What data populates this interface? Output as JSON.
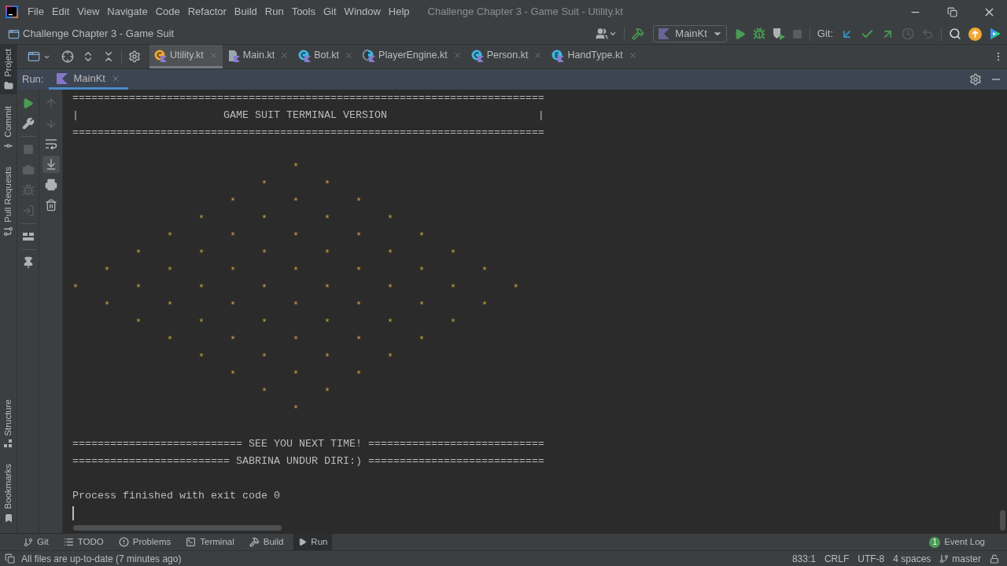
{
  "title_bar": {
    "menu": [
      "File",
      "Edit",
      "View",
      "Navigate",
      "Code",
      "Refactor",
      "Build",
      "Run",
      "Tools",
      "Git",
      "Window",
      "Help"
    ],
    "title": "Challenge Chapter 3 - Game Suit - Utility.kt"
  },
  "navigation_bar": {
    "project": "Challenge Chapter 3 - Game Suit",
    "left_actions": [
      {
        "kind": "account"
      },
      {
        "kind": "build"
      }
    ],
    "run_configuration": "MainKt",
    "run_actions": [
      {
        "kind": "run",
        "disabled": false
      },
      {
        "kind": "debug",
        "disabled": false
      },
      {
        "kind": "coverage",
        "disabled": false
      },
      {
        "kind": "stop",
        "disabled": true
      }
    ],
    "git_label": "Git:",
    "git_actions": [
      {
        "kind": "update",
        "disabled": false
      },
      {
        "kind": "commit",
        "disabled": false
      },
      {
        "kind": "push",
        "disabled": false
      },
      {
        "kind": "history",
        "disabled": true
      },
      {
        "kind": "rollback",
        "disabled": true
      }
    ],
    "end_actions": [
      {
        "kind": "search"
      },
      {
        "kind": "ide-update"
      },
      {
        "kind": "toolbox"
      }
    ]
  },
  "tool_strip": {
    "top": [
      {
        "kind": "project",
        "label": "Project",
        "selected": true
      },
      {
        "kind": "commit",
        "label": "Commit",
        "selected": false
      },
      {
        "kind": "pull-requests",
        "label": "Pull Requests",
        "selected": false
      }
    ],
    "bottom": [
      {
        "kind": "structure",
        "label": "Structure",
        "selected": false
      },
      {
        "kind": "bookmarks",
        "label": "Bookmarks",
        "selected": false
      }
    ]
  },
  "editor_tabs": [
    {
      "kind": "object",
      "label": "Utility.kt",
      "selected": true
    },
    {
      "kind": "file",
      "label": "Main.kt",
      "selected": false
    },
    {
      "kind": "class",
      "label": "Bot.kt",
      "selected": false
    },
    {
      "kind": "abstract",
      "label": "PlayerEngine.kt",
      "selected": false
    },
    {
      "kind": "class",
      "label": "Person.kt",
      "selected": false
    },
    {
      "kind": "enum",
      "label": "HandType.kt",
      "selected": false
    }
  ],
  "run_window": {
    "label": "Run:",
    "tabs": [
      {
        "label": "MainKt",
        "selected": true
      }
    ],
    "toolbar_left": [
      {
        "items": [
          {
            "kind": "rerun",
            "disabled": false
          },
          {
            "kind": "settings",
            "disabled": false
          }
        ]
      },
      {
        "items": [
          {
            "kind": "stop",
            "disabled": true
          },
          {
            "kind": "dump",
            "disabled": true
          },
          {
            "kind": "debug",
            "disabled": true
          },
          {
            "kind": "exit",
            "disabled": true
          }
        ]
      },
      {
        "items": [
          {
            "kind": "layout",
            "disabled": false
          }
        ]
      },
      {
        "items": [
          {
            "kind": "pin",
            "disabled": false
          }
        ]
      }
    ],
    "toolbar_right": [
      {
        "kind": "previous",
        "disabled": true,
        "on": false
      },
      {
        "kind": "next",
        "disabled": true,
        "on": false
      },
      {
        "kind": "wrap",
        "disabled": false,
        "on": false
      },
      {
        "kind": "scroll-end",
        "disabled": false,
        "on": true
      },
      {
        "kind": "print",
        "disabled": false,
        "on": false
      },
      {
        "kind": "clear",
        "disabled": false,
        "on": false
      }
    ],
    "console": [
      {
        "kind": "text",
        "text": "==========================================================================="
      },
      {
        "kind": "text",
        "text": "|                       GAME SUIT TERMINAL VERSION                        |"
      },
      {
        "kind": "text",
        "text": "==========================================================================="
      },
      {
        "kind": "blank"
      },
      {
        "kind": "pattern",
        "text": "                                   *\n                              *         *\n                         *         *         *\n                    *         *         *         *\n               *         *         *         *         *\n          *         *         *         *         *         *\n     *         *         *         *         *         *         *\n*         *         *         *         *         *         *         *\n     *         *         *         *         *         *         *\n          *         *         *         *         *         *\n               *         *         *         *         *\n                    *         *         *         *\n                         *         *         *\n                              *         *\n                                   *"
      },
      {
        "kind": "blank"
      },
      {
        "kind": "text",
        "text": "=========================== SEE YOU NEXT TIME! ============================"
      },
      {
        "kind": "text",
        "text": "========================= SABRINA UNDUR DIRI:) ============================"
      },
      {
        "kind": "blank"
      },
      {
        "kind": "text",
        "text": "Process finished with exit code 0"
      },
      {
        "kind": "cursor"
      }
    ]
  },
  "bottom_toolbar": {
    "items": [
      {
        "kind": "git",
        "label": "Git",
        "selected": false
      },
      {
        "kind": "todo",
        "label": "TODO",
        "selected": false
      },
      {
        "kind": "problems",
        "label": "Problems",
        "selected": false
      },
      {
        "kind": "terminal",
        "label": "Terminal",
        "selected": false
      },
      {
        "kind": "build",
        "label": "Build",
        "selected": false
      },
      {
        "kind": "run",
        "label": "Run",
        "selected": true
      }
    ],
    "event_log": {
      "label": "Event Log",
      "count": "1"
    }
  },
  "status_bar": {
    "message": "All files are up-to-date (7 minutes ago)",
    "position": "833:1",
    "line_separator": "CRLF",
    "encoding": "UTF-8",
    "indent": "4 spaces",
    "branch": "master"
  }
}
